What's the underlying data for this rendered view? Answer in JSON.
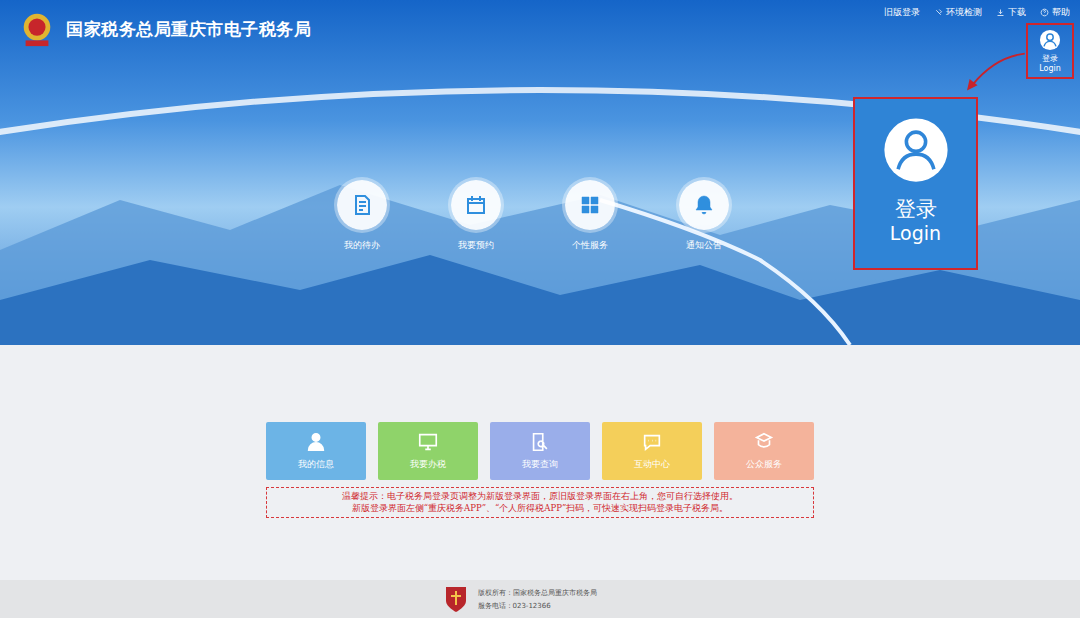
{
  "header": {
    "title": "国家税务总局重庆市电子税务局"
  },
  "top_links": [
    "旧版登录",
    "环境检测",
    "下载",
    "帮助"
  ],
  "login": {
    "label": "登录",
    "sublabel": "Login"
  },
  "callout": {
    "label": "登录",
    "sublabel": "Login"
  },
  "hero_items": [
    {
      "label": "我的待办"
    },
    {
      "label": "我要预约"
    },
    {
      "label": "个性服务"
    },
    {
      "label": "通知公告"
    }
  ],
  "cards": [
    {
      "label": "我的信息",
      "color": "#6cb4e6"
    },
    {
      "label": "我要办税",
      "color": "#8fd36a"
    },
    {
      "label": "我要查询",
      "color": "#9aaeea"
    },
    {
      "label": "互动中心",
      "color": "#f4cf5a"
    },
    {
      "label": "公众服务",
      "color": "#f4b39b"
    }
  ],
  "notice": [
    "温馨提示：电子税务局登录页调整为新版登录界面，原旧版登录界面在右上角，您可自行选择使用。",
    "新版登录界面左侧“重庆税务APP”、“个人所得税APP”扫码，可快速实现扫码登录电子税务局。"
  ],
  "footer": [
    "版权所有：国家税务总局重庆市税务局",
    "服务电话：023-12366"
  ]
}
